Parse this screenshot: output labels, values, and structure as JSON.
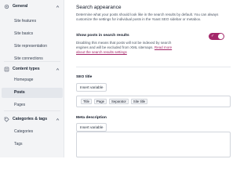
{
  "sidebar": {
    "sections": [
      {
        "heading": "General",
        "icon": "settings-icon",
        "items": [
          {
            "label": "Site features"
          },
          {
            "label": "Site basics"
          },
          {
            "label": "Site representation"
          },
          {
            "label": "Site connections"
          }
        ]
      },
      {
        "heading": "Content types",
        "icon": "content-types-icon",
        "items": [
          {
            "label": "Homepage"
          },
          {
            "label": "Posts",
            "active": true
          },
          {
            "label": "Pages"
          }
        ]
      },
      {
        "heading": "Categories & tags",
        "icon": "tag-icon",
        "items": [
          {
            "label": "Categories"
          },
          {
            "label": "Tags"
          }
        ]
      }
    ]
  },
  "main": {
    "title": "Search appearance",
    "description": "Determine what your posts should look like in the search results by default. You can always customize the settings for individual posts in the Yoast SEO sidebar or metabox.",
    "toggle": {
      "label": "Show posts in search results",
      "checked": true,
      "help": "Disabling this means that posts will not be indexed by search engines and will be excluded from XML sitemaps.",
      "link": "Read more about the search results settings",
      "accent": "#a4286a"
    },
    "seo_title": {
      "label": "SEO title",
      "button": "Insert variable",
      "tags": [
        "Title",
        "Page",
        "Separator",
        "Site title"
      ]
    },
    "meta_description": {
      "label": "Meta description",
      "button": "Insert variable"
    }
  }
}
